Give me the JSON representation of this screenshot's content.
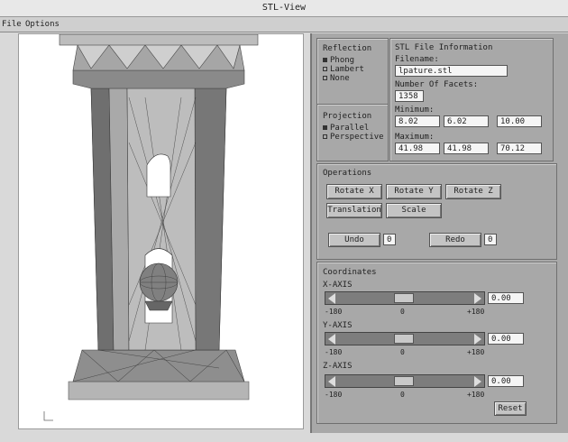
{
  "window": {
    "title": "STL-View"
  },
  "menu": {
    "file": "File",
    "options": "Options"
  },
  "reflection": {
    "title": "Reflection",
    "options": [
      "Phong",
      "Lambert",
      "None"
    ]
  },
  "projection": {
    "title": "Projection",
    "options": [
      "Parallel",
      "Perspective"
    ]
  },
  "info": {
    "title": "STL File Information",
    "filename_label": "Filename:",
    "filename": "lpature.stl",
    "facets_label": "Number Of Facets:",
    "facets": "1358",
    "min_label": "Minimum:",
    "min": [
      "8.02",
      "6.02",
      "10.00"
    ],
    "max_label": "Maximum:",
    "max": [
      "41.98",
      "41.98",
      "70.12"
    ]
  },
  "operations": {
    "title": "Operations",
    "rotate_x": "Rotate X",
    "rotate_y": "Rotate Y",
    "rotate_z": "Rotate Z",
    "translation": "Translation",
    "scale": "Scale",
    "undo": "Undo",
    "undo_count": "0",
    "redo": "Redo",
    "redo_count": "0"
  },
  "coordinates": {
    "title": "Coordinates",
    "axes": [
      {
        "label": "X-AXIS",
        "min": "-180",
        "mid": "0",
        "max": "+180",
        "value": "0.00"
      },
      {
        "label": "Y-AXIS",
        "min": "-180",
        "mid": "0",
        "max": "+180",
        "value": "0.00"
      },
      {
        "label": "Z-AXIS",
        "min": "-180",
        "mid": "0",
        "max": "+180",
        "value": "0.00"
      }
    ],
    "reset": "Reset"
  }
}
